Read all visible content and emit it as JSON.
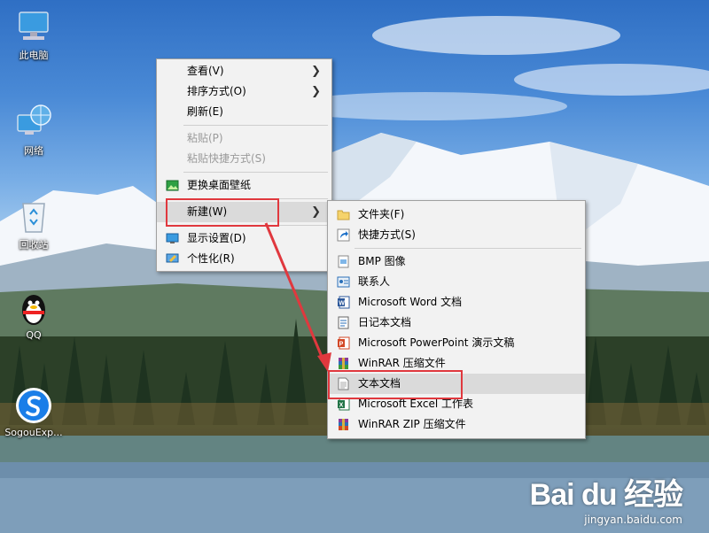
{
  "desktop": {
    "icons": [
      {
        "label": "此电脑",
        "icon": "computer-icon"
      },
      {
        "label": "网络",
        "icon": "network-icon"
      },
      {
        "label": "回收站",
        "icon": "recycle-bin-icon"
      },
      {
        "label": "QQ",
        "icon": "qq-penguin-icon"
      },
      {
        "label": "SogouExp...",
        "icon": "sogou-explorer-icon"
      }
    ]
  },
  "context_menu": {
    "items": [
      {
        "label": "查看(V)",
        "submenu": true,
        "disabled": false
      },
      {
        "label": "排序方式(O)",
        "submenu": true,
        "disabled": false
      },
      {
        "label": "刷新(E)",
        "submenu": false,
        "disabled": false
      },
      {
        "label": "粘贴(P)",
        "submenu": false,
        "disabled": true
      },
      {
        "label": "粘贴快捷方式(S)",
        "submenu": false,
        "disabled": true
      },
      {
        "label": "更换桌面壁纸",
        "submenu": false,
        "disabled": false,
        "icon": "wallpaper-icon"
      },
      {
        "label": "新建(W)",
        "submenu": true,
        "disabled": false,
        "highlighted": true
      },
      {
        "label": "显示设置(D)",
        "submenu": false,
        "disabled": false,
        "icon": "display-settings-icon"
      },
      {
        "label": "个性化(R)",
        "submenu": false,
        "disabled": false,
        "icon": "personalize-icon"
      }
    ],
    "arrow": ">"
  },
  "new_submenu": {
    "items": [
      {
        "label": "文件夹(F)",
        "icon": "folder-icon"
      },
      {
        "label": "快捷方式(S)",
        "icon": "shortcut-icon"
      },
      {
        "label": "BMP 图像",
        "icon": "bmp-image-icon"
      },
      {
        "label": "联系人",
        "icon": "contact-icon"
      },
      {
        "label": "Microsoft Word 文档",
        "icon": "word-icon"
      },
      {
        "label": "日记本文档",
        "icon": "journal-icon"
      },
      {
        "label": "Microsoft PowerPoint 演示文稿",
        "icon": "powerpoint-icon"
      },
      {
        "label": "WinRAR 压缩文件",
        "icon": "winrar-icon"
      },
      {
        "label": "文本文档",
        "icon": "text-document-icon",
        "highlighted": true
      },
      {
        "label": "Microsoft Excel 工作表",
        "icon": "excel-icon"
      },
      {
        "label": "WinRAR ZIP 压缩文件",
        "icon": "winrar-zip-icon"
      }
    ]
  },
  "watermark": {
    "logo": "Bai du 经验",
    "url": "jingyan.baidu.com"
  },
  "colors": {
    "menu_bg": "#f2f2f2",
    "highlight": "#dadada",
    "annotation_red": "#e0383e"
  }
}
